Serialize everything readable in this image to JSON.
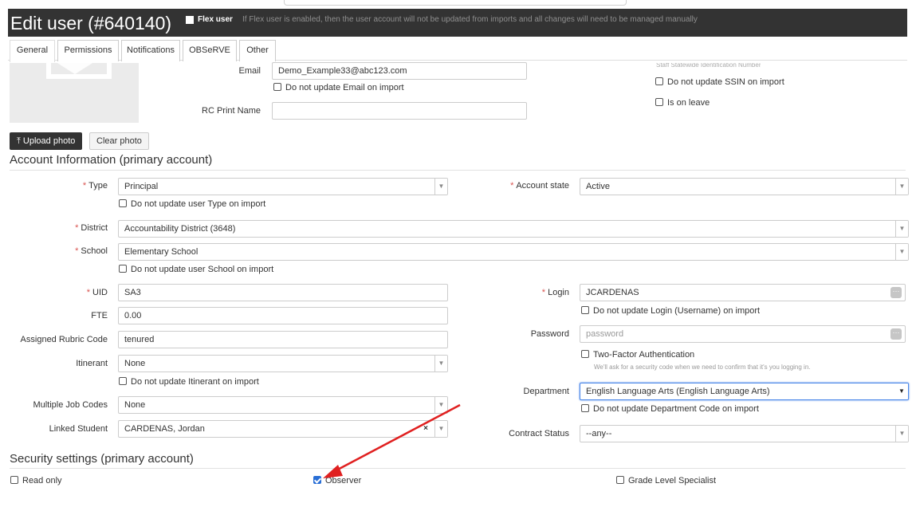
{
  "header": {
    "title": "Edit user (#640140)",
    "flex_label": "Flex user",
    "flex_desc": "If Flex user is enabled, then the user account will not be updated from imports and all changes will need to be managed manually"
  },
  "tabs": [
    {
      "label": "General"
    },
    {
      "label": "Permissions"
    },
    {
      "label": "Notifications"
    },
    {
      "label": "OBSeRVE"
    },
    {
      "label": "Other"
    }
  ],
  "profile": {
    "email_label": "Email",
    "email_value": "Demo_Example33@abc123.com",
    "email_noupdate": "Do not update Email on import",
    "rc_label": "RC Print Name",
    "rc_value": "",
    "ssin_label": "Staff Statewide Identification Number",
    "ssin_noupdate": "Do not update SSIN on import",
    "on_leave": "Is on leave",
    "upload_photo": "Upload photo",
    "clear_photo": "Clear photo"
  },
  "account": {
    "section_title": "Account Information (primary account)",
    "type_label": "Type",
    "type_value": "Principal",
    "type_noupdate": "Do not update user Type on import",
    "state_label": "Account state",
    "state_value": "Active",
    "district_label": "District",
    "district_value": "Accountability District (3648)",
    "school_label": "School",
    "school_value": "Elementary School",
    "school_noupdate": "Do not update user School on import",
    "uid_label": "UID",
    "uid_value": "SA3",
    "login_label": "Login",
    "login_value": "JCARDENAS",
    "login_noupdate": "Do not update Login (Username) on import",
    "fte_label": "FTE",
    "fte_value": "0.00",
    "password_label": "Password",
    "password_placeholder": "password",
    "rubric_label": "Assigned Rubric Code",
    "rubric_value": "tenured",
    "twofactor_label": "Two-Factor Authentication",
    "twofactor_hint": "We'll ask for a security code when we need to confirm that it's you logging in.",
    "itinerant_label": "Itinerant",
    "itinerant_value": "None",
    "itinerant_noupdate": "Do not update Itinerant on import",
    "department_label": "Department",
    "department_value": "English Language Arts (English Language Arts)",
    "department_noupdate": "Do not update Department Code on import",
    "jobcodes_label": "Multiple Job Codes",
    "jobcodes_value": "None",
    "linked_label": "Linked Student",
    "linked_value": "CARDENAS, Jordan",
    "contract_label": "Contract Status",
    "contract_value": "--any--"
  },
  "security": {
    "section_title": "Security settings (primary account)",
    "read_only": "Read only",
    "observer": "Observer",
    "observer_checked": true,
    "grade_level": "Grade Level Specialist"
  },
  "colors": {
    "header_bg": "#333333",
    "required": "#d9534f",
    "checkbox_on": "#2a6fd6",
    "annotation_arrow": "#e02020"
  }
}
